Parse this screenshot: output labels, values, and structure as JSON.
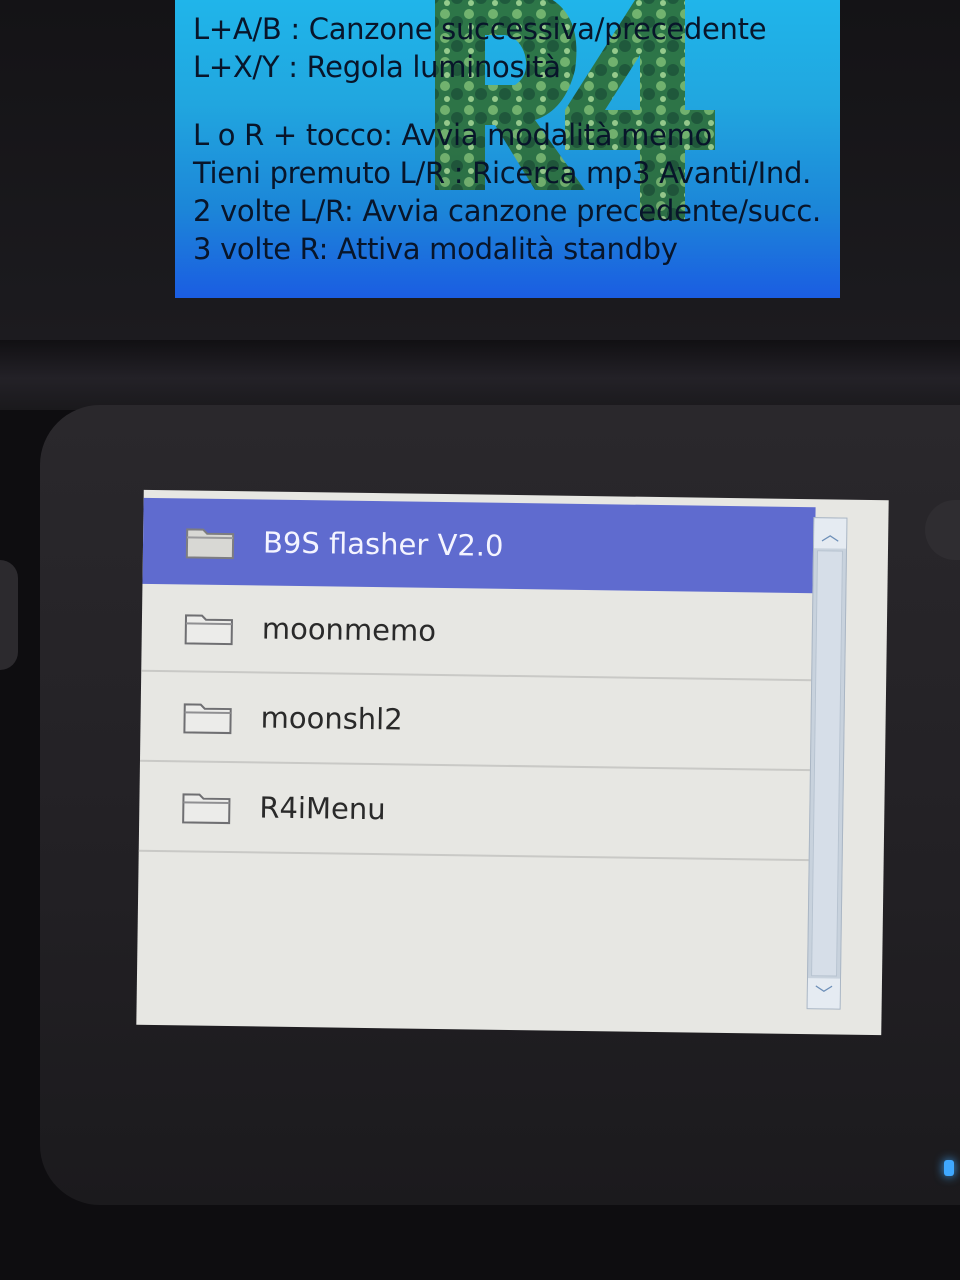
{
  "top_screen": {
    "lines": [
      "L+A/B : Canzone successiva/precedente",
      "L+X/Y : Regola luminosità",
      "",
      "L o R + tocco: Avvia modalità memo",
      "Tieni premuto L/R : Ricerca mp3 Avanti/Ind.",
      "2 volte L/R: Avvia canzone precedente/succ.",
      "3 volte R: Attiva modalità standby"
    ]
  },
  "file_list": {
    "items": [
      {
        "label": "B9S flasher V2.0",
        "icon": "folder-icon",
        "selected": true
      },
      {
        "label": "moonmemo",
        "icon": "folder-icon",
        "selected": false
      },
      {
        "label": "moonshl2",
        "icon": "folder-icon",
        "selected": false
      },
      {
        "label": "R4iMenu",
        "icon": "folder-icon",
        "selected": false
      }
    ]
  },
  "scrollbar": {
    "up_icon": "chevron-up-icon",
    "down_icon": "chevron-down-icon",
    "up_glyph": "︿",
    "down_glyph": "﹀"
  },
  "colors": {
    "selection": "#5f6bcf",
    "list_background": "#e7e7e3",
    "top_screen_blue": "#1c86d8",
    "led": "#3fa8ff"
  }
}
